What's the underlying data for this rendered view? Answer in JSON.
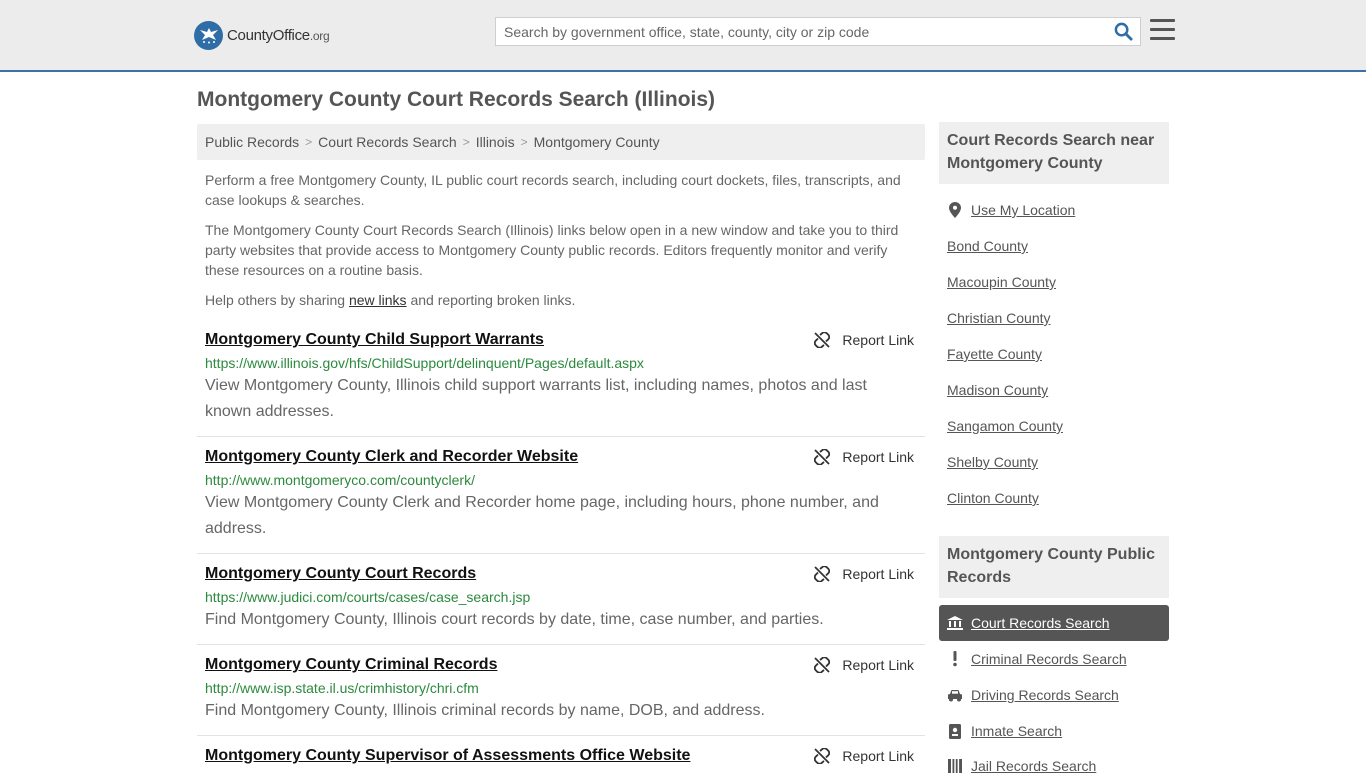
{
  "header": {
    "logo_main": "CountyOffice",
    "logo_tld": ".org",
    "search_placeholder": "Search by government office, state, county, city or zip code"
  },
  "page": {
    "title": "Montgomery County Court Records Search (Illinois)"
  },
  "breadcrumb": [
    "Public Records",
    "Court Records Search",
    "Illinois",
    "Montgomery County"
  ],
  "intro": {
    "p1": "Perform a free Montgomery County, IL public court records search, including court dockets, files, transcripts, and case lookups & searches.",
    "p2": "The Montgomery County Court Records Search (Illinois) links below open in a new window and take you to third party websites that provide access to Montgomery County public records. Editors frequently monitor and verify these resources on a routine basis.",
    "p3_before": "Help others by sharing ",
    "p3_link": "new links",
    "p3_after": " and reporting broken links."
  },
  "report_label": "Report Link",
  "results": [
    {
      "title": "Montgomery County Child Support Warrants",
      "url": "https://www.illinois.gov/hfs/ChildSupport/delinquent/Pages/default.aspx",
      "desc": "View Montgomery County, Illinois child support warrants list, including names, photos and last known addresses."
    },
    {
      "title": "Montgomery County Clerk and Recorder Website",
      "url": "http://www.montgomeryco.com/countyclerk/",
      "desc": "View Montgomery County Clerk and Recorder home page, including hours, phone number, and address."
    },
    {
      "title": "Montgomery County Court Records",
      "url": "https://www.judici.com/courts/cases/case_search.jsp",
      "desc": "Find Montgomery County, Illinois court records by date, time, case number, and parties."
    },
    {
      "title": "Montgomery County Criminal Records",
      "url": "http://www.isp.state.il.us/crimhistory/chri.cfm",
      "desc": "Find Montgomery County, Illinois criminal records by name, DOB, and address."
    },
    {
      "title": "Montgomery County Supervisor of Assessments Office Website",
      "url": "",
      "desc": ""
    }
  ],
  "sidebar": {
    "near_heading": "Court Records Search near Montgomery County",
    "use_location": "Use My Location",
    "near_counties": [
      "Bond County",
      "Macoupin County",
      "Christian County",
      "Fayette County",
      "Madison County",
      "Sangamon County",
      "Shelby County",
      "Clinton County"
    ],
    "public_heading": "Montgomery County Public Records",
    "public_links": [
      {
        "label": "Court Records Search",
        "icon": "courthouse-icon",
        "active": true
      },
      {
        "label": "Criminal Records Search",
        "icon": "exclamation-icon",
        "active": false
      },
      {
        "label": "Driving Records Search",
        "icon": "car-icon",
        "active": false
      },
      {
        "label": "Inmate Search",
        "icon": "id-badge-icon",
        "active": false
      },
      {
        "label": "Jail Records Search",
        "icon": "jail-icon",
        "active": false
      }
    ]
  },
  "colors": {
    "accent": "#3a72a6",
    "url_green": "#2b8a3e",
    "active_bg": "#555555"
  }
}
